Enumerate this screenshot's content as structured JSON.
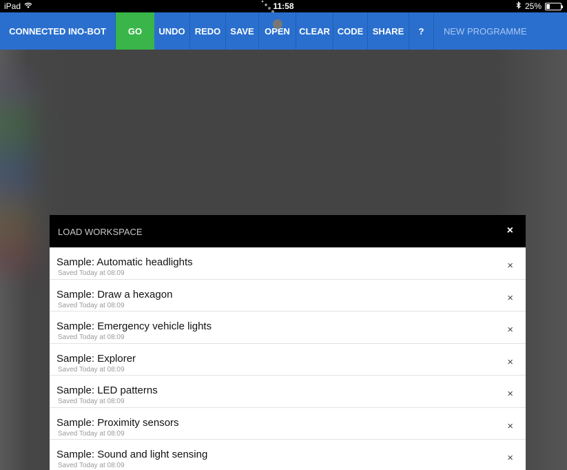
{
  "status_bar": {
    "device": "iPad",
    "time": "11:58",
    "battery_text": "25%",
    "battery_level": 0.25
  },
  "toolbar": {
    "title": "CONNECTED INO-BOT",
    "go": "GO",
    "undo": "UNDO",
    "redo": "REDO",
    "save": "SAVE",
    "open": "OPEN",
    "clear": "CLEAR",
    "code": "CODE",
    "share": "SHARE",
    "help": "?",
    "new_programme": "NEW PROGRAMME"
  },
  "modal": {
    "title": "LOAD WORKSPACE",
    "close_glyph": "×",
    "delete_glyph": "×",
    "items": [
      {
        "name": "Sample: Automatic headlights",
        "saved": "Saved Today at 08:09"
      },
      {
        "name": "Sample: Draw a hexagon",
        "saved": "Saved Today at 08:09"
      },
      {
        "name": "Sample: Emergency vehicle lights",
        "saved": "Saved Today at 08:09"
      },
      {
        "name": "Sample: Explorer",
        "saved": "Saved Today at 08:09"
      },
      {
        "name": "Sample: LED patterns",
        "saved": "Saved Today at 08:09"
      },
      {
        "name": "Sample: Proximity sensors",
        "saved": "Saved Today at 08:09"
      },
      {
        "name": "Sample: Sound and light sensing",
        "saved": "Saved Today at 08:09"
      }
    ]
  },
  "colors": {
    "toolbar_blue": "#2a6fce",
    "go_green": "#39b54a",
    "modal_header": "#000000"
  },
  "icons": [
    "wifi-icon",
    "bluetooth-icon",
    "battery-icon",
    "close-icon",
    "delete-icon"
  ]
}
